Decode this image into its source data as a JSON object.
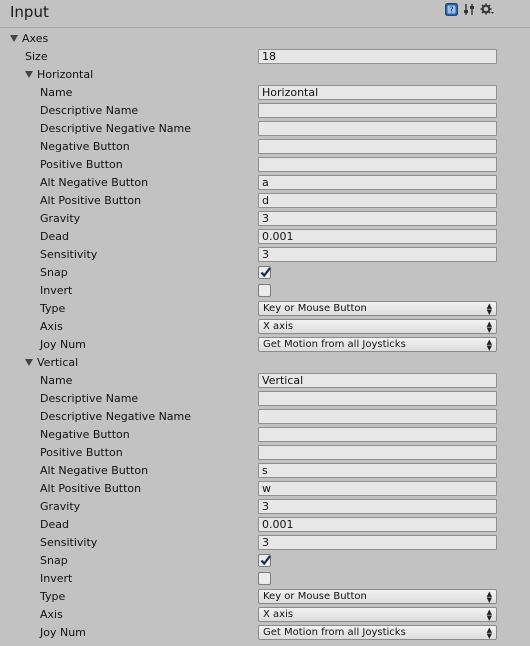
{
  "header": {
    "title": "Input"
  },
  "axes": {
    "label": "Axes",
    "size_label": "Size",
    "size_value": "18",
    "entries": [
      {
        "name": "Horizontal",
        "fields": {
          "name": {
            "label": "Name",
            "value": "Horizontal"
          },
          "descriptive_name": {
            "label": "Descriptive Name",
            "value": ""
          },
          "descriptive_negative_name": {
            "label": "Descriptive Negative Name",
            "value": ""
          },
          "negative_button": {
            "label": "Negative Button",
            "value": ""
          },
          "positive_button": {
            "label": "Positive Button",
            "value": ""
          },
          "alt_negative_button": {
            "label": "Alt Negative Button",
            "value": "a"
          },
          "alt_positive_button": {
            "label": "Alt Positive Button",
            "value": "d"
          },
          "gravity": {
            "label": "Gravity",
            "value": "3"
          },
          "dead": {
            "label": "Dead",
            "value": "0.001"
          },
          "sensitivity": {
            "label": "Sensitivity",
            "value": "3"
          },
          "snap": {
            "label": "Snap",
            "checked": true
          },
          "invert": {
            "label": "Invert",
            "checked": false
          },
          "type": {
            "label": "Type",
            "value": "Key or Mouse Button"
          },
          "axis": {
            "label": "Axis",
            "value": "X axis"
          },
          "joy_num": {
            "label": "Joy Num",
            "value": "Get Motion from all Joysticks"
          }
        }
      },
      {
        "name": "Vertical",
        "fields": {
          "name": {
            "label": "Name",
            "value": "Vertical"
          },
          "descriptive_name": {
            "label": "Descriptive Name",
            "value": ""
          },
          "descriptive_negative_name": {
            "label": "Descriptive Negative Name",
            "value": ""
          },
          "negative_button": {
            "label": "Negative Button",
            "value": ""
          },
          "positive_button": {
            "label": "Positive Button",
            "value": ""
          },
          "alt_negative_button": {
            "label": "Alt Negative Button",
            "value": "s"
          },
          "alt_positive_button": {
            "label": "Alt Positive Button",
            "value": "w"
          },
          "gravity": {
            "label": "Gravity",
            "value": "3"
          },
          "dead": {
            "label": "Dead",
            "value": "0.001"
          },
          "sensitivity": {
            "label": "Sensitivity",
            "value": "3"
          },
          "snap": {
            "label": "Snap",
            "checked": true
          },
          "invert": {
            "label": "Invert",
            "checked": false
          },
          "type": {
            "label": "Type",
            "value": "Key or Mouse Button"
          },
          "axis": {
            "label": "Axis",
            "value": "X axis"
          },
          "joy_num": {
            "label": "Joy Num",
            "value": "Get Motion from all Joysticks"
          }
        }
      }
    ]
  }
}
